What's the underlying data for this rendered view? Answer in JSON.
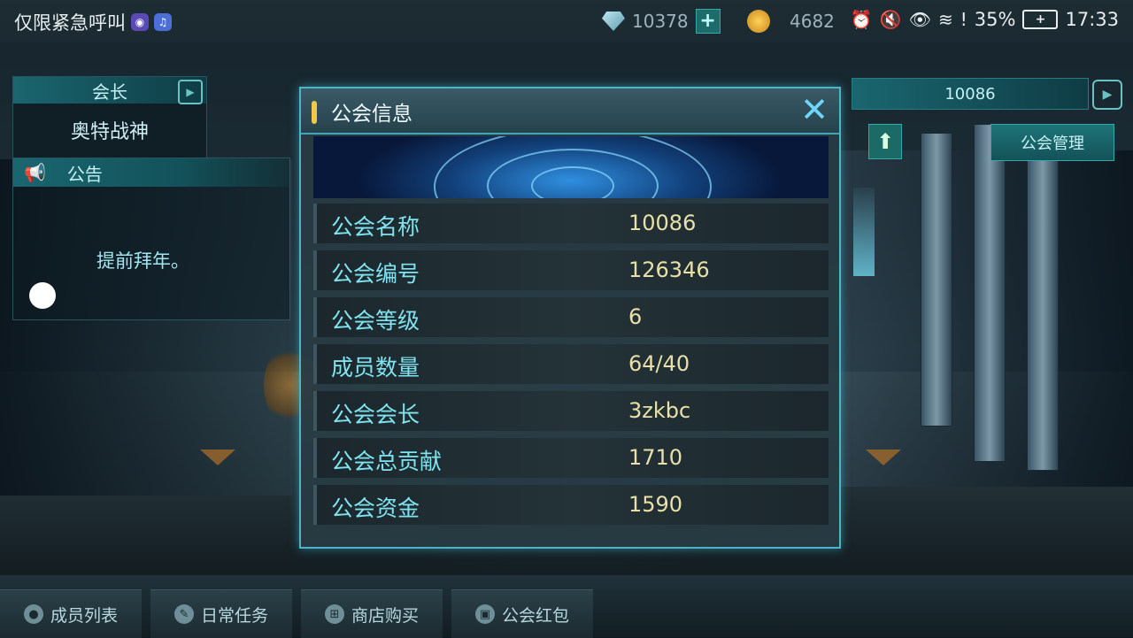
{
  "status_bar": {
    "emergency_text": "仅限紧急呼叫",
    "gems": "10378",
    "coins": "4682",
    "battery": "35%",
    "time": "17:33"
  },
  "leader_panel": {
    "title": "会长",
    "name": "奥特战神"
  },
  "notice_panel": {
    "title": "公告",
    "text": "提前拜年。"
  },
  "right_panel": {
    "guild_name": "10086",
    "manage_label": "公会管理"
  },
  "modal": {
    "title": "公会信息",
    "rows": [
      {
        "label": "公会名称",
        "value": "10086"
      },
      {
        "label": "公会编号",
        "value": "126346"
      },
      {
        "label": "公会等级",
        "value": "6"
      },
      {
        "label": "成员数量",
        "value": "64/40"
      },
      {
        "label": "公会会长",
        "value": "3zkbc"
      },
      {
        "label": "公会总贡献",
        "value": "1710"
      },
      {
        "label": "公会资金",
        "value": "1590"
      }
    ]
  },
  "tabs": [
    {
      "label": "成员列表",
      "icon": "user-icon"
    },
    {
      "label": "日常任务",
      "icon": "task-edit-icon"
    },
    {
      "label": "商店购买",
      "icon": "cart-icon"
    },
    {
      "label": "公会红包",
      "icon": "red-packet-icon"
    }
  ]
}
